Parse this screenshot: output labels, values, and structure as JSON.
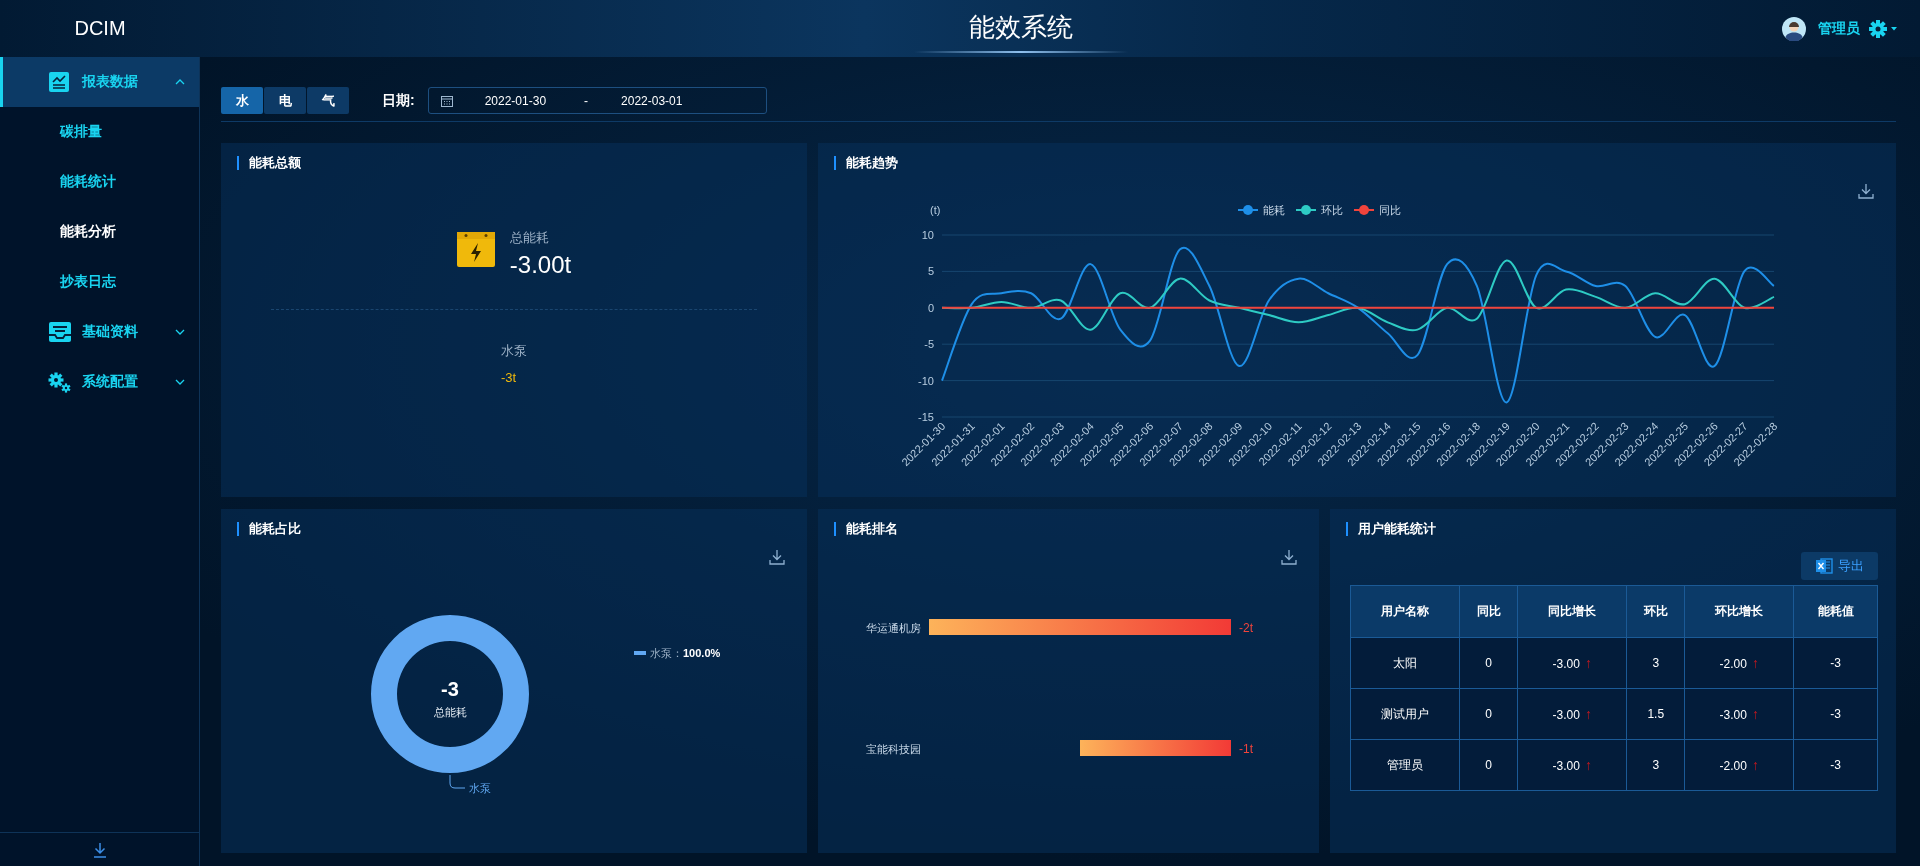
{
  "header": {
    "logo": "DCIM",
    "title": "能效系统",
    "user": "管理员"
  },
  "sidebar": {
    "items": [
      {
        "label": "报表数据",
        "expanded": true,
        "children": [
          {
            "label": "碳排量",
            "selected": false
          },
          {
            "label": "能耗统计",
            "selected": false
          },
          {
            "label": "能耗分析",
            "selected": true
          },
          {
            "label": "抄表日志",
            "selected": false
          }
        ]
      },
      {
        "label": "基础资料",
        "expanded": false
      },
      {
        "label": "系统配置",
        "expanded": false
      }
    ]
  },
  "filters": {
    "tabs": [
      {
        "label": "水",
        "selected": true
      },
      {
        "label": "电",
        "selected": false
      },
      {
        "label": "气",
        "selected": false
      }
    ],
    "date_label": "日期:",
    "date_start": "2022-01-30",
    "date_separator": "-",
    "date_end": "2022-03-01"
  },
  "total_panel": {
    "title": "能耗总额",
    "summary_label": "总能耗",
    "summary_value": "-3.00t",
    "items": [
      {
        "name": "水泵",
        "value": "-3t"
      }
    ]
  },
  "trend_panel": {
    "title": "能耗趋势",
    "chart_data": {
      "type": "line",
      "ylabel": "(t)",
      "ylim": [
        -15,
        10
      ],
      "yticks": [
        -15,
        -10,
        -5,
        0,
        5,
        10
      ],
      "categories": [
        "2022-01-30",
        "2022-01-31",
        "2022-02-01",
        "2022-02-02",
        "2022-02-03",
        "2022-02-04",
        "2022-02-05",
        "2022-02-06",
        "2022-02-07",
        "2022-02-08",
        "2022-02-09",
        "2022-02-10",
        "2022-02-11",
        "2022-02-12",
        "2022-02-13",
        "2022-02-14",
        "2022-02-15",
        "2022-02-16",
        "2022-02-18",
        "2022-02-19",
        "2022-02-20",
        "2022-02-21",
        "2022-02-22",
        "2022-02-23",
        "2022-02-24",
        "2022-02-25",
        "2022-02-26",
        "2022-02-27",
        "2022-02-28"
      ],
      "series": [
        {
          "name": "能耗",
          "color": "#1e8fe8",
          "values": [
            -10,
            0.5,
            2,
            2,
            -1.5,
            6,
            -3,
            -4.5,
            8,
            3,
            -8,
            1,
            4,
            2,
            0,
            -3.5,
            -6.5,
            6,
            3,
            -13,
            4.5,
            5,
            3,
            3,
            -4,
            -1,
            -8,
            5,
            3
          ]
        },
        {
          "name": "环比",
          "color": "#2ecbc4",
          "values": [
            0,
            0,
            0.8,
            0,
            1,
            -3,
            2,
            0,
            4,
            1,
            0,
            -1,
            -2,
            -1,
            0,
            -2,
            -3,
            0,
            -1.5,
            6.5,
            0,
            2.5,
            1.5,
            0,
            2,
            0.5,
            4,
            0,
            1.5
          ]
        },
        {
          "name": "同比",
          "color": "#f0443c",
          "values": [
            0,
            0,
            0,
            0,
            0,
            0,
            0,
            0,
            0,
            0,
            0,
            0,
            0,
            0,
            0,
            0,
            0,
            0,
            0,
            0,
            0,
            0,
            0,
            0,
            0,
            0,
            0,
            0,
            0
          ]
        }
      ],
      "grid": true,
      "legend": true
    }
  },
  "share_panel": {
    "title": "能耗占比",
    "center_value": "-3",
    "center_label": "总能耗",
    "legend": [
      {
        "name": "水泵：",
        "value": "100.0%"
      }
    ],
    "chart_data": {
      "type": "donut",
      "categories": [
        "水泵"
      ],
      "values": [
        100
      ],
      "colors": [
        "#61a8f2"
      ]
    }
  },
  "ranking_panel": {
    "title": "能耗排名",
    "chart_data": {
      "type": "bar",
      "orientation": "horizontal",
      "categories": [
        "华运通机房",
        "宝能科技园"
      ],
      "values": [
        -2,
        -1
      ],
      "value_labels": [
        "-2t",
        "-1t"
      ]
    }
  },
  "user_table_panel": {
    "title": "用户能耗统计",
    "export_button": "导出",
    "columns": [
      "用户名称",
      "同比",
      "同比增长",
      "环比",
      "环比增长",
      "能耗值"
    ],
    "rows": [
      [
        {
          "text": "太阳"
        },
        {
          "text": "0"
        },
        {
          "text": "-3.00",
          "arrow": "↑"
        },
        {
          "text": "3"
        },
        {
          "text": "-2.00",
          "arrow": "↑"
        },
        {
          "text": "-3"
        }
      ],
      [
        {
          "text": "测试用户"
        },
        {
          "text": "0"
        },
        {
          "text": "-3.00",
          "arrow": "↑"
        },
        {
          "text": "1.5"
        },
        {
          "text": "-3.00",
          "arrow": "↑"
        },
        {
          "text": "-3"
        }
      ],
      [
        {
          "text": "管理员"
        },
        {
          "text": "0"
        },
        {
          "text": "-3.00",
          "arrow": "↑"
        },
        {
          "text": "3"
        },
        {
          "text": "-2.00",
          "arrow": "↑"
        },
        {
          "text": "-3"
        }
      ]
    ]
  }
}
